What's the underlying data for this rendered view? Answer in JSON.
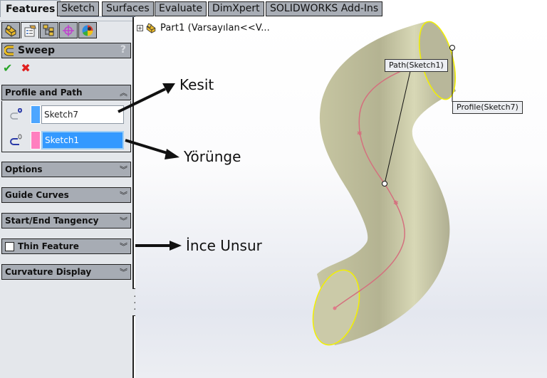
{
  "tabs": [
    {
      "label": "Features",
      "active": true
    },
    {
      "label": "Sketch"
    },
    {
      "label": "Surfaces"
    },
    {
      "label": "Evaluate"
    },
    {
      "label": "DimXpert"
    },
    {
      "label": "SOLIDWORKS Add-Ins"
    }
  ],
  "manager_tabs": [
    {
      "icon": "feature-manager-icon"
    },
    {
      "icon": "property-manager-icon",
      "active": true
    },
    {
      "icon": "configuration-manager-icon"
    },
    {
      "icon": "dimxpert-manager-icon"
    },
    {
      "icon": "display-manager-icon"
    }
  ],
  "property_manager": {
    "title": "Sweep",
    "help": "?",
    "ok": "✔",
    "cancel": "✖",
    "groups": {
      "profile_path": {
        "label": "Profile and Path",
        "expanded": true
      },
      "options": {
        "label": "Options"
      },
      "guide_curves": {
        "label": "Guide Curves"
      },
      "tangency": {
        "label": "Start/End Tangency"
      },
      "thin_feature": {
        "label": "Thin Feature",
        "checked": false
      },
      "curvature": {
        "label": "Curvature Display"
      }
    },
    "profile": {
      "value": "Sketch7",
      "color": "#4da6ff"
    },
    "path": {
      "value": "Sketch1",
      "color": "#ff7fbf",
      "selected": true
    },
    "chevron_up": "︽",
    "chevron_down": "︾"
  },
  "feature_tree": {
    "label": "Part1  (Varsayılan<<V..."
  },
  "callouts": {
    "path": "Path(Sketch1)",
    "profile": "Profile(Sketch7)"
  },
  "annotations": {
    "profile": "Kesit",
    "path": "Yörünge",
    "thin": "İnce Unsur"
  },
  "colors": {
    "accent_selection": "#3399ff",
    "edge_highlight": "#ffff00",
    "path_curve": "#d4707e",
    "body": "#c9c8a8"
  }
}
